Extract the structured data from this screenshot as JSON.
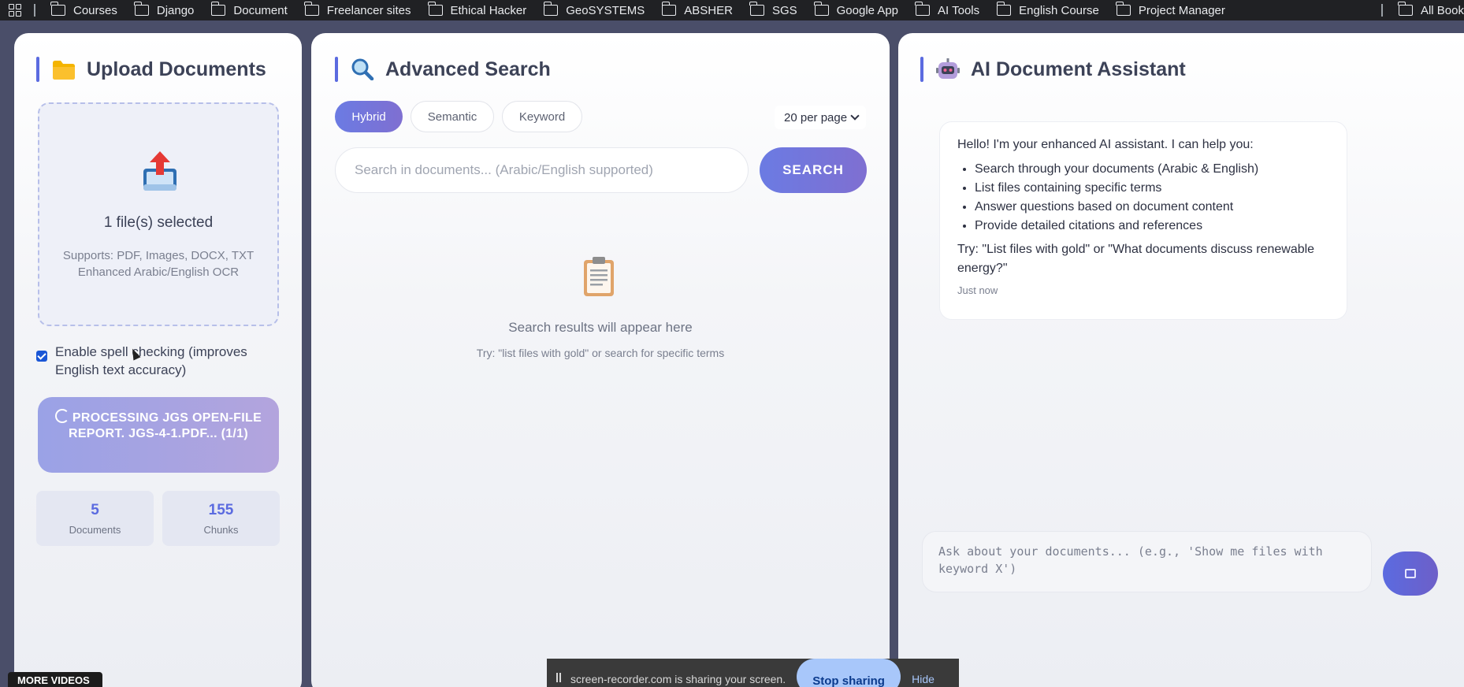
{
  "bookmarks": {
    "items": [
      "Courses",
      "Django",
      "Document",
      "Freelancer sites",
      "Ethical Hacker",
      "GeoSYSTEMS",
      "ABSHER",
      "SGS",
      "Google App",
      "AI Tools",
      "English Course",
      "Project Manager"
    ],
    "all_bookmarks": "All Book"
  },
  "upload": {
    "title": "Upload Documents",
    "file_count": "1 file(s) selected",
    "supports_line1": "Supports: PDF, Images, DOCX, TXT",
    "supports_line2": "Enhanced Arabic/English OCR",
    "spellcheck_label": "Enable spell checking (improves English text accuracy)",
    "spellcheck_checked": true,
    "processing_label": "PROCESSING JGS OPEN-FILE REPORT. JGS-4-1.PDF... (1/1)",
    "stats": [
      {
        "value": "5",
        "label": "Documents"
      },
      {
        "value": "155",
        "label": "Chunks"
      }
    ]
  },
  "search": {
    "title": "Advanced Search",
    "modes": [
      "Hybrid",
      "Semantic",
      "Keyword"
    ],
    "active_mode": "Hybrid",
    "per_page": "20 per page",
    "placeholder": "Search in documents... (Arabic/English supported)",
    "button_label": "SEARCH",
    "empty_text": "Search results will appear here",
    "empty_hint": "Try: \"list files with gold\" or search for specific terms"
  },
  "assistant": {
    "title": "AI Document Assistant",
    "message": {
      "greeting": "Hello! I'm your enhanced AI assistant. I can help you:",
      "bullets": [
        "Search through your documents (Arabic & English)",
        "List files containing specific terms",
        "Answer questions based on document content",
        "Provide detailed citations and references"
      ],
      "try_text": "Try: \"List files with gold\" or \"What documents discuss renewable energy?\"",
      "time": "Just now"
    },
    "input_placeholder": "Ask about your documents... (e.g., 'Show me files with keyword X')"
  },
  "overlay": {
    "more_videos": "MORE VIDEOS",
    "share_text": "screen-recorder.com is sharing your screen.",
    "stop_sharing": "Stop sharing",
    "hide": "Hide"
  },
  "colors": {
    "accent": "#5b6be0",
    "accent_gradient_end": "#7f6fd1",
    "bookmark_bar": "#202124",
    "background": "#4a4e69"
  }
}
